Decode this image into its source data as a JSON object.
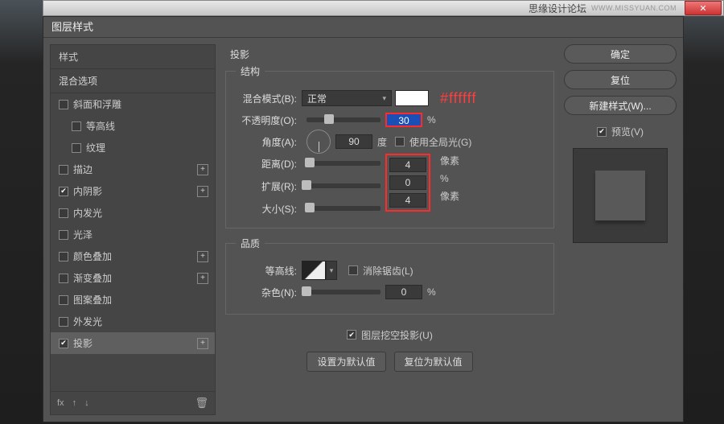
{
  "titlebar": {
    "watermark": "思缘设计论坛",
    "url": "WWW.MISSYUAN.COM",
    "close": "✕"
  },
  "dialog": {
    "title": "图层样式"
  },
  "styles": {
    "header": "样式",
    "subheader": "混合选项",
    "items": [
      {
        "label": "斜面和浮雕",
        "checked": false,
        "plus": false,
        "indent": false
      },
      {
        "label": "等高线",
        "checked": false,
        "plus": false,
        "indent": true
      },
      {
        "label": "纹理",
        "checked": false,
        "plus": false,
        "indent": true
      },
      {
        "label": "描边",
        "checked": false,
        "plus": true,
        "indent": false
      },
      {
        "label": "内阴影",
        "checked": true,
        "plus": true,
        "indent": false
      },
      {
        "label": "内发光",
        "checked": false,
        "plus": false,
        "indent": false
      },
      {
        "label": "光泽",
        "checked": false,
        "plus": false,
        "indent": false
      },
      {
        "label": "颜色叠加",
        "checked": false,
        "plus": true,
        "indent": false
      },
      {
        "label": "渐变叠加",
        "checked": false,
        "plus": true,
        "indent": false
      },
      {
        "label": "图案叠加",
        "checked": false,
        "plus": false,
        "indent": false
      },
      {
        "label": "外发光",
        "checked": false,
        "plus": false,
        "indent": false
      },
      {
        "label": "投影",
        "checked": true,
        "plus": true,
        "indent": false,
        "active": true
      }
    ],
    "footer_fx": "fx"
  },
  "section": {
    "title": "投影",
    "structure_legend": "结构",
    "quality_legend": "品质",
    "blend_mode_label": "混合模式(B):",
    "blend_mode_value": "正常",
    "hex_annotation": "#ffffff",
    "opacity_label": "不透明度(O):",
    "opacity_value": "30",
    "opacity_unit": "%",
    "angle_label": "角度(A):",
    "angle_value": "90",
    "angle_unit": "度",
    "global_light_label": "使用全局光(G)",
    "distance_label": "距离(D):",
    "distance_value": "4",
    "distance_unit": "像素",
    "spread_label": "扩展(R):",
    "spread_value": "0",
    "spread_unit": "%",
    "size_label": "大小(S):",
    "size_value": "4",
    "size_unit": "像素",
    "contour_label": "等高线:",
    "antialias_label": "消除锯齿(L)",
    "noise_label": "杂色(N):",
    "noise_value": "0",
    "noise_unit": "%",
    "knockout_label": "图层挖空投影(U)",
    "set_default": "设置为默认值",
    "reset_default": "复位为默认值"
  },
  "buttons": {
    "ok": "确定",
    "reset": "复位",
    "new_style": "新建样式(W)...",
    "preview": "预览(V)"
  }
}
